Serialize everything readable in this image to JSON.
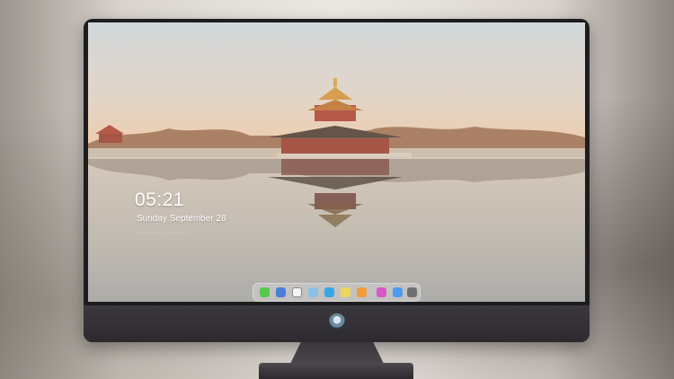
{
  "lock_screen": {
    "time": "05:21",
    "date": "Sunday September  28",
    "tiny_status_text": "··········································"
  },
  "dock": {
    "apps": [
      {
        "name": "messages-icon",
        "color": "#58c84c"
      },
      {
        "name": "finder-icon",
        "color": "#4b7fd6"
      },
      {
        "name": "safari-icon",
        "color": "#f4f4f4"
      },
      {
        "name": "files-icon",
        "color": "#8cc0e6"
      },
      {
        "name": "video-icon",
        "color": "#3aa6e8"
      },
      {
        "name": "notes-icon",
        "color": "#f2d45c"
      },
      {
        "name": "photos-icon",
        "color": "#f29c3a"
      },
      {
        "name": "itunes-icon",
        "color": "#d957c6"
      },
      {
        "name": "appstore-icon",
        "color": "#4d9cf0"
      },
      {
        "name": "camera-icon",
        "color": "#707070"
      }
    ]
  },
  "colors": {
    "sky_top": "#cfd5d8",
    "sky_bottom": "#f2c79d",
    "wall": "#c7b9a8",
    "roof": "#a24b3b"
  }
}
